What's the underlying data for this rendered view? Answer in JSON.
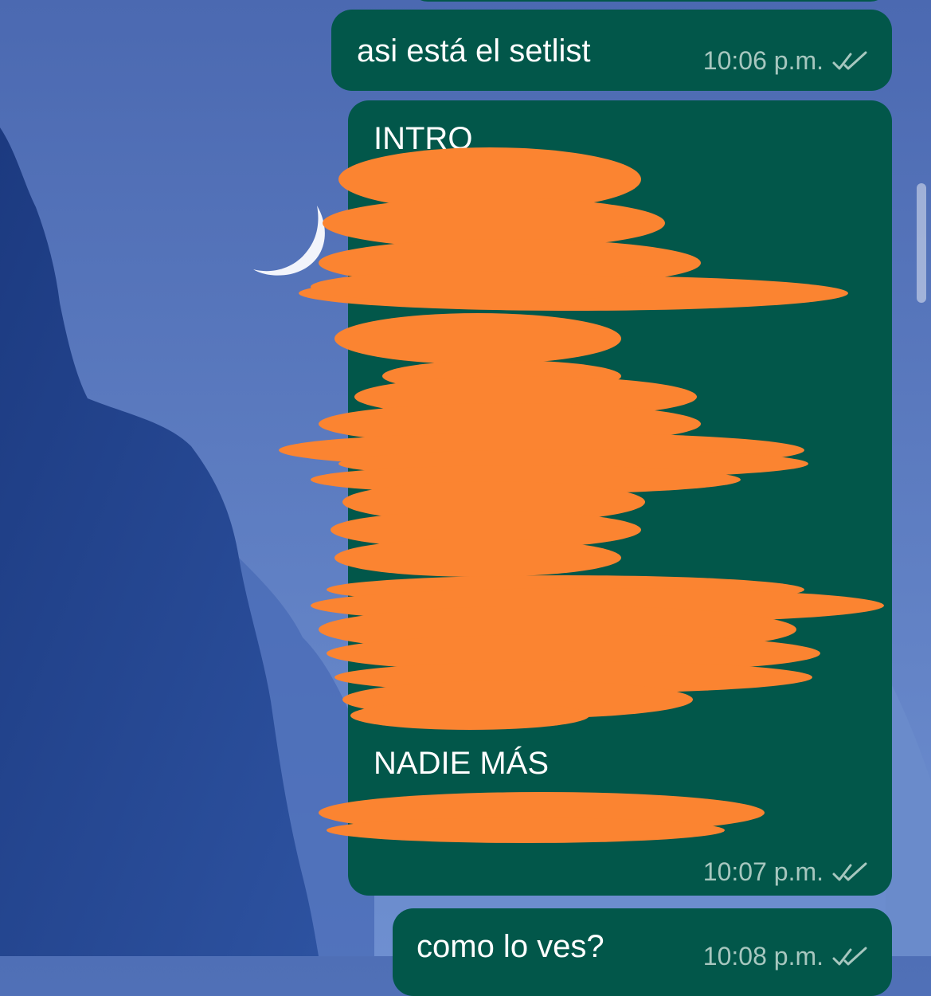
{
  "colors": {
    "bubble_outgoing": "#02574a",
    "meta_text": "#a7c7bf",
    "redaction": "#fb8431",
    "wallpaper_sky": "#5b7cc2",
    "wallpaper_mountain": "#1f3f86"
  },
  "messages": [
    {
      "text": "asi está el setlist",
      "time": "10:06 p.m.",
      "status_icon": "double-check-icon"
    },
    {
      "lines": [
        {
          "text": "INTRO"
        },
        {
          "text": "NADIE MÁS"
        }
      ],
      "time": "10:07 p.m.",
      "status_icon": "double-check-icon"
    },
    {
      "text": "como lo ves?",
      "time": "10:08 p.m.",
      "status_icon": "double-check-icon"
    }
  ]
}
